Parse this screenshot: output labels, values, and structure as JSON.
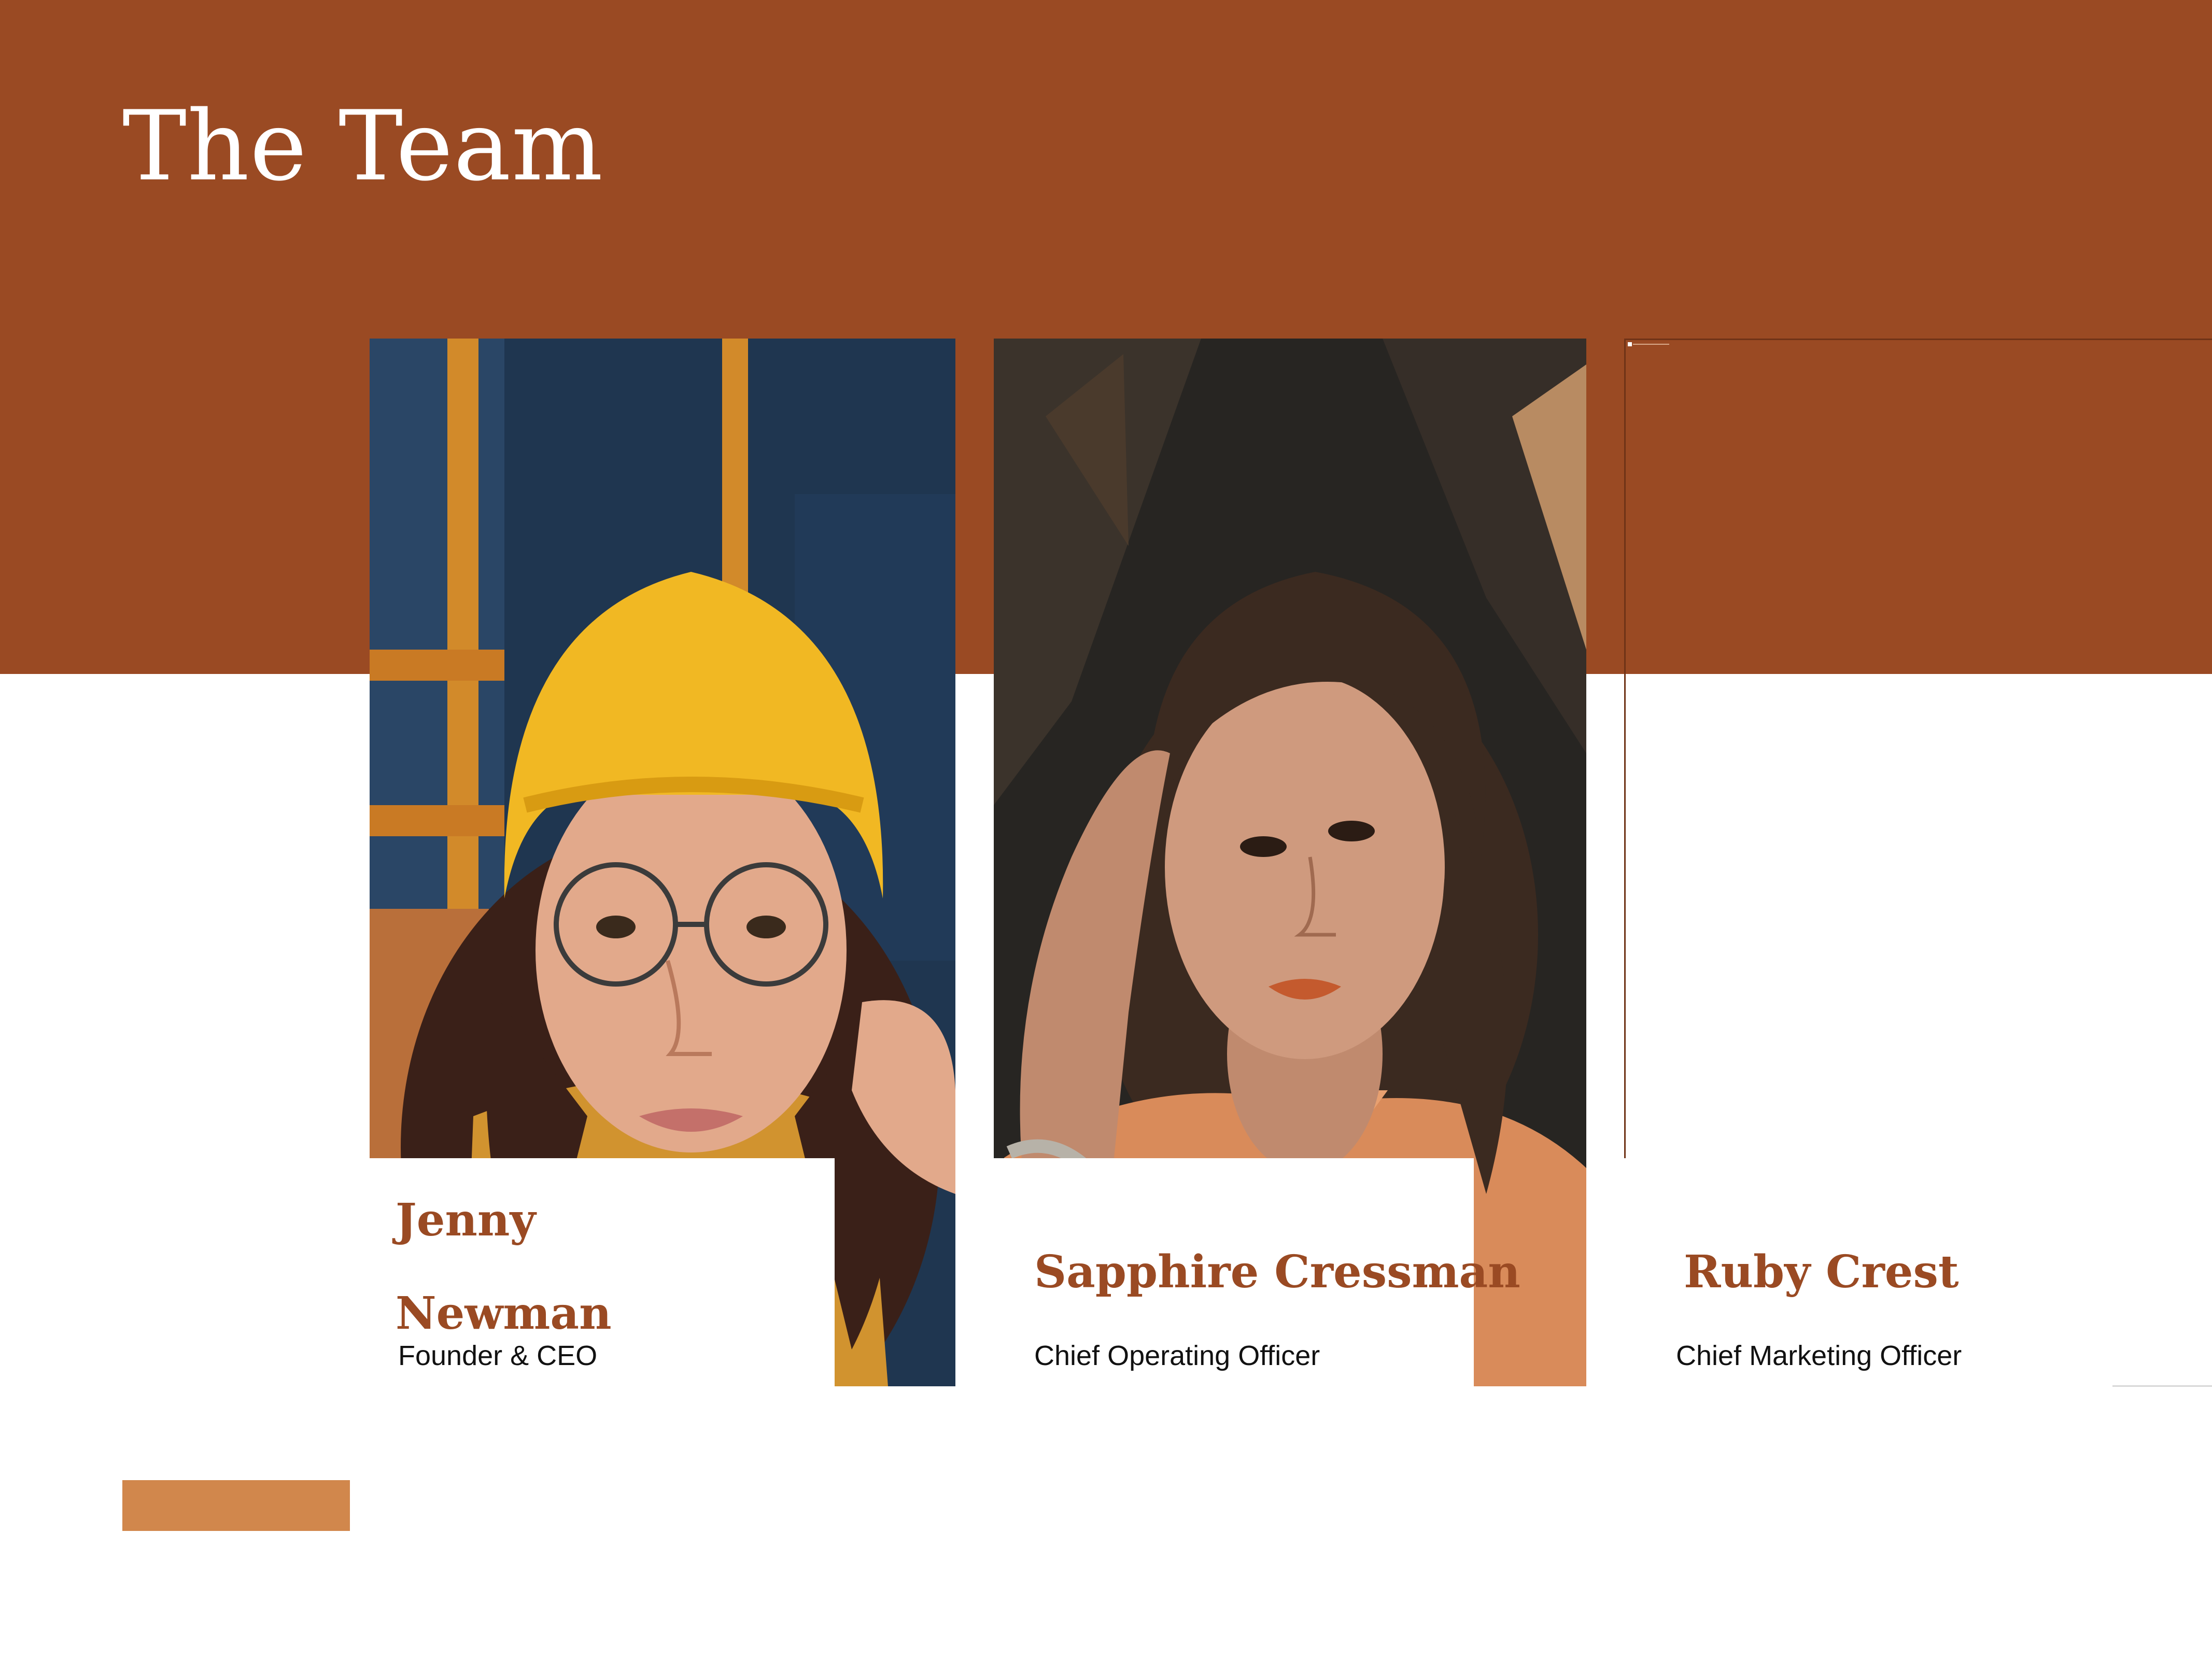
{
  "page": {
    "title": "The Team"
  },
  "colors": {
    "band": "#9a4a23",
    "accent": "#d1874c",
    "name_text": "#9a4a23",
    "role_text": "#111111"
  },
  "team": [
    {
      "name": "Jenny Newman",
      "role": "Founder & CEO",
      "photo": "portrait-yellow-beanie-glasses"
    },
    {
      "name": "Sapphire Cressman",
      "role": "Chief Operating Officer",
      "photo": "portrait-orange-shirt"
    },
    {
      "name": "Ruby Crest",
      "role": "Chief Marketing Officer",
      "photo": "missing-photo"
    }
  ]
}
